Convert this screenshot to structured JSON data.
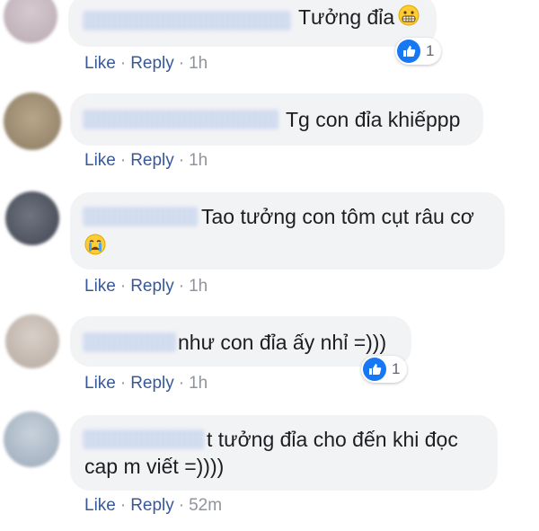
{
  "comments": [
    {
      "text_lines": [
        "Tưởng đỉa"
      ],
      "emoji": "grimacing-face",
      "actions": {
        "like": "Like",
        "separator": "·",
        "reply": "Reply",
        "time": "1h"
      },
      "reaction_count": "1"
    },
    {
      "text_lines": [
        "Tg con đỉa khiếppp"
      ],
      "actions": {
        "like": "Like",
        "separator": "·",
        "reply": "Reply",
        "time": "1h"
      }
    },
    {
      "text_lines": [
        "Tao tưởng con tôm cụt râu cơ"
      ],
      "emoji": "crying-face",
      "actions": {
        "like": "Like",
        "separator": "·",
        "reply": "Reply",
        "time": "1h"
      }
    },
    {
      "text_lines": [
        "như con đỉa ấy nhỉ =)))"
      ],
      "actions": {
        "like": "Like",
        "separator": "·",
        "reply": "Reply",
        "time": "1h"
      },
      "reaction_count": "1"
    },
    {
      "text_lines": [
        "t tưởng đỉa cho đến khi đọc",
        "cap m viết =))))"
      ],
      "actions": {
        "like": "Like",
        "separator": "·",
        "reply": "Reply",
        "time": "52m"
      }
    }
  ],
  "colors": {
    "bubble": "#f2f3f5",
    "link": "#385898",
    "meta": "#90949c",
    "text": "#1c1e21",
    "like_badge": "#1877f2"
  }
}
